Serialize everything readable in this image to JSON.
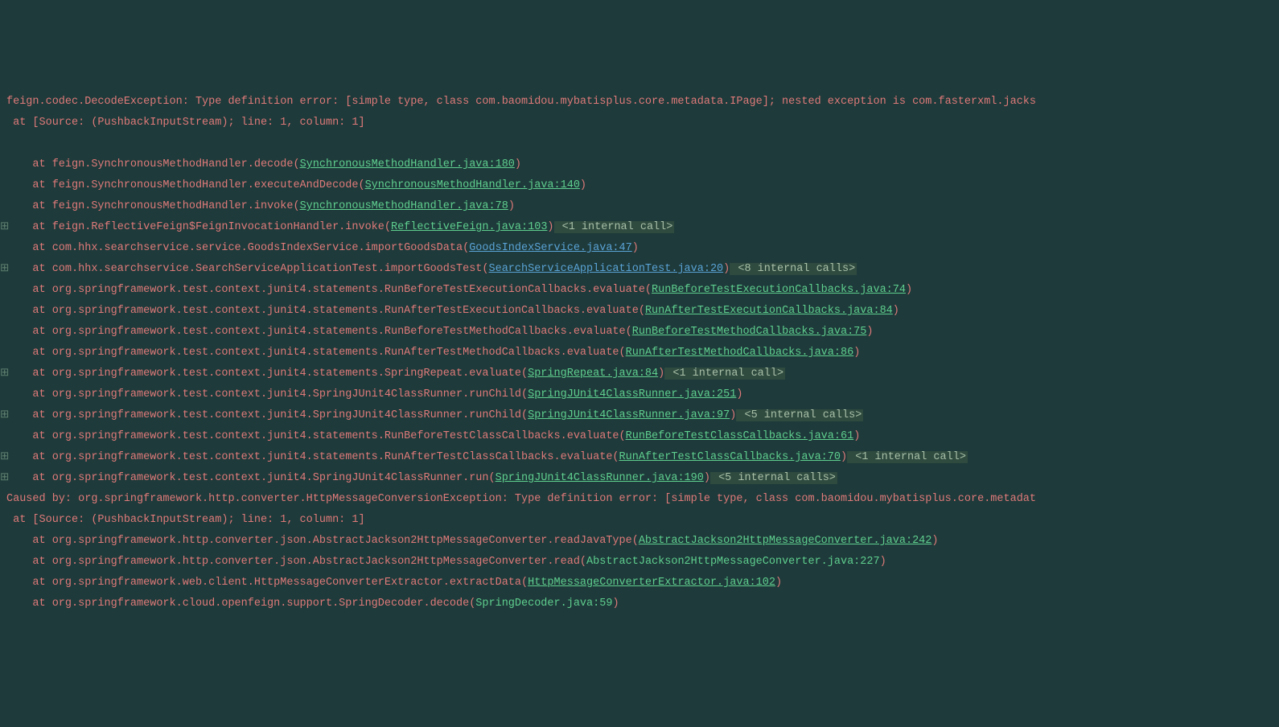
{
  "stacktrace": {
    "header_line1": "feign.codec.DecodeException: Type definition error: [simple type, class com.baomidou.mybatisplus.core.metadata.IPage]; nested exception is com.fasterxml.jacks",
    "header_line2": " at [Source: (PushbackInputStream); line: 1, column: 1]",
    "frames": [
      {
        "gutter": "",
        "prefix": "    at feign.SynchronousMethodHandler.decode(",
        "link": "SynchronousMethodHandler.java:180",
        "link_kind": "green",
        "suffix": ")",
        "tag": ""
      },
      {
        "gutter": "",
        "prefix": "    at feign.SynchronousMethodHandler.executeAndDecode(",
        "link": "SynchronousMethodHandler.java:140",
        "link_kind": "green",
        "suffix": ")",
        "tag": ""
      },
      {
        "gutter": "",
        "prefix": "    at feign.SynchronousMethodHandler.invoke(",
        "link": "SynchronousMethodHandler.java:78",
        "link_kind": "green",
        "suffix": ")",
        "tag": ""
      },
      {
        "gutter": "⊞",
        "prefix": "    at feign.ReflectiveFeign$FeignInvocationHandler.invoke(",
        "link": "ReflectiveFeign.java:103",
        "link_kind": "green",
        "suffix": ")",
        "tag": " <1 internal call>"
      },
      {
        "gutter": "",
        "prefix": "    at com.hhx.searchservice.service.GoodsIndexService.importGoodsData(",
        "link": "GoodsIndexService.java:47",
        "link_kind": "blue",
        "suffix": ")",
        "tag": ""
      },
      {
        "gutter": "⊞",
        "prefix": "    at com.hhx.searchservice.SearchServiceApplicationTest.importGoodsTest(",
        "link": "SearchServiceApplicationTest.java:20",
        "link_kind": "blue",
        "suffix": ")",
        "tag": " <8 internal calls>"
      },
      {
        "gutter": "",
        "prefix": "    at org.springframework.test.context.junit4.statements.RunBeforeTestExecutionCallbacks.evaluate(",
        "link": "RunBeforeTestExecutionCallbacks.java:74",
        "link_kind": "green",
        "suffix": ")",
        "tag": ""
      },
      {
        "gutter": "",
        "prefix": "    at org.springframework.test.context.junit4.statements.RunAfterTestExecutionCallbacks.evaluate(",
        "link": "RunAfterTestExecutionCallbacks.java:84",
        "link_kind": "green",
        "suffix": ")",
        "tag": ""
      },
      {
        "gutter": "",
        "prefix": "    at org.springframework.test.context.junit4.statements.RunBeforeTestMethodCallbacks.evaluate(",
        "link": "RunBeforeTestMethodCallbacks.java:75",
        "link_kind": "green",
        "suffix": ")",
        "tag": ""
      },
      {
        "gutter": "",
        "prefix": "    at org.springframework.test.context.junit4.statements.RunAfterTestMethodCallbacks.evaluate(",
        "link": "RunAfterTestMethodCallbacks.java:86",
        "link_kind": "green",
        "suffix": ")",
        "tag": ""
      },
      {
        "gutter": "⊞",
        "prefix": "    at org.springframework.test.context.junit4.statements.SpringRepeat.evaluate(",
        "link": "SpringRepeat.java:84",
        "link_kind": "green",
        "suffix": ")",
        "tag": " <1 internal call>"
      },
      {
        "gutter": "",
        "prefix": "    at org.springframework.test.context.junit4.SpringJUnit4ClassRunner.runChild(",
        "link": "SpringJUnit4ClassRunner.java:251",
        "link_kind": "green",
        "suffix": ")",
        "tag": ""
      },
      {
        "gutter": "⊞",
        "prefix": "    at org.springframework.test.context.junit4.SpringJUnit4ClassRunner.runChild(",
        "link": "SpringJUnit4ClassRunner.java:97",
        "link_kind": "green",
        "suffix": ")",
        "tag": " <5 internal calls>"
      },
      {
        "gutter": "",
        "prefix": "    at org.springframework.test.context.junit4.statements.RunBeforeTestClassCallbacks.evaluate(",
        "link": "RunBeforeTestClassCallbacks.java:61",
        "link_kind": "green",
        "suffix": ")",
        "tag": ""
      },
      {
        "gutter": "⊞",
        "prefix": "    at org.springframework.test.context.junit4.statements.RunAfterTestClassCallbacks.evaluate(",
        "link": "RunAfterTestClassCallbacks.java:70",
        "link_kind": "green",
        "suffix": ")",
        "tag": " <1 internal call>"
      },
      {
        "gutter": "⊞",
        "prefix": "    at org.springframework.test.context.junit4.SpringJUnit4ClassRunner.run(",
        "link": "SpringJUnit4ClassRunner.java:190",
        "link_kind": "green",
        "suffix": ")",
        "tag": " <5 internal calls>"
      }
    ],
    "caused_by": "Caused by: org.springframework.http.converter.HttpMessageConversionException: Type definition error: [simple type, class com.baomidou.mybatisplus.core.metadat",
    "caused_by_line2": " at [Source: (PushbackInputStream); line: 1, column: 1]",
    "caused_frames": [
      {
        "prefix": "    at org.springframework.http.converter.json.AbstractJackson2HttpMessageConverter.readJavaType(",
        "link": "AbstractJackson2HttpMessageConverter.java:242",
        "link_kind": "green",
        "suffix": ")"
      },
      {
        "prefix": "    at org.springframework.http.converter.json.AbstractJackson2HttpMessageConverter.read(",
        "link": "AbstractJackson2HttpMessageConverter.java:227",
        "link_kind": "plain",
        "suffix": ")"
      },
      {
        "prefix": "    at org.springframework.web.client.HttpMessageConverterExtractor.extractData(",
        "link": "HttpMessageConverterExtractor.java:102",
        "link_kind": "green",
        "suffix": ")"
      },
      {
        "prefix": "    at org.springframework.cloud.openfeign.support.SpringDecoder.decode(",
        "link": "SpringDecoder.java:59",
        "link_kind": "plain",
        "suffix": ")"
      }
    ]
  }
}
